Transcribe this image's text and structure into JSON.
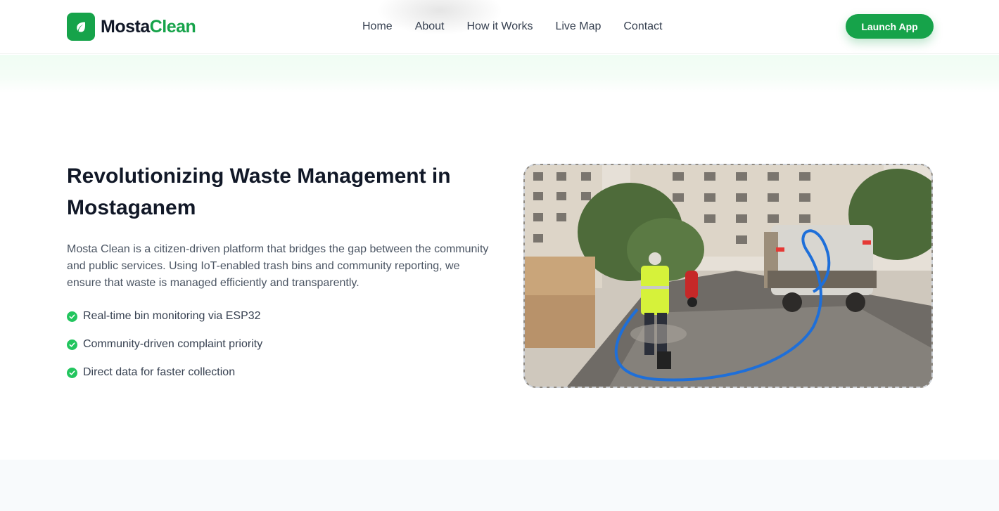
{
  "nav": {
    "brand_part1": "Mosta",
    "brand_part2": "Clean",
    "links": [
      {
        "label": "Home"
      },
      {
        "label": "About"
      },
      {
        "label": "How it Works"
      },
      {
        "label": "Live Map"
      },
      {
        "label": "Contact"
      }
    ],
    "cta_label": "Launch App"
  },
  "hero": {
    "title": "Revolutionizing Waste Management in Mostaganem",
    "description": "Mosta Clean is a citizen-driven platform that bridges the gap between the community and public services. Using IoT-enabled trash bins and community reporting, we ensure that waste is managed efficiently and transparently.",
    "features": [
      {
        "text": "Real-time bin monitoring via ESP32"
      },
      {
        "text": "Community-driven complaint priority"
      },
      {
        "text": "Direct data for faster collection"
      }
    ]
  },
  "colors": {
    "brand_green": "#16a34a",
    "check_green": "#22c55e",
    "heading": "#111827",
    "body_text": "#4b5563"
  },
  "icons": {
    "logo": "leaf-icon",
    "feature_bullet": "check-circle-icon"
  }
}
